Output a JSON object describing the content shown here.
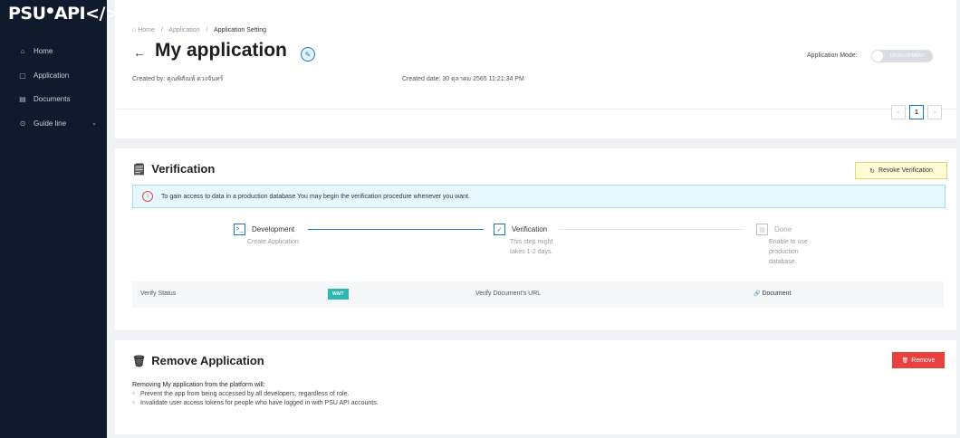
{
  "sidebar": {
    "logo": {
      "part1": "PSU",
      "dot": "●",
      "part2": "API</>"
    },
    "items": [
      {
        "icon": "⌂",
        "label": "Home"
      },
      {
        "icon": "▢",
        "label": "Application"
      },
      {
        "icon": "▤",
        "label": "Documents"
      },
      {
        "icon": "⊙",
        "label": "Guide line",
        "chevron": "⌄"
      }
    ]
  },
  "header": {
    "breadcrumb": [
      "Home",
      "Application",
      "Application Setting"
    ],
    "breadcrumb_sep": "/",
    "home_icon": "⌂",
    "back_icon": "←",
    "title": "My application",
    "edit_icon": "✎",
    "created_by_label": "Created by:",
    "created_by": "คุณพิสัณห์ ดวงจันทร์",
    "created_date_label": "Created date:",
    "created_date": "30 ตุลาคม 2565 11:21:34 PM",
    "mode_label": "Application Mode:",
    "mode_value": "DEVELOPMENT",
    "pager": {
      "prev": "‹",
      "current": "1",
      "next": "›"
    }
  },
  "verification": {
    "icon": "🗒",
    "title": "Verification",
    "revoke_icon": "↻",
    "revoke_label": "Revoke Verification",
    "alert_icon": "!",
    "alert_text": "To gain access to data in a production database You may begin the verification procedure whenever you want.",
    "steps": [
      {
        "icon": ">_",
        "title": "Development",
        "desc": "Create Application"
      },
      {
        "icon": "✓",
        "title": "Verification",
        "desc": "This step might takes 1-2 days."
      },
      {
        "icon": "▤",
        "title": "Done",
        "desc": "Enable to use production database."
      }
    ],
    "status_label": "Verify Status",
    "status_badge": "WAIT",
    "doc_url_label": "Verify Document's URL",
    "doc_link_icon": "🔗",
    "doc_link": "Document"
  },
  "remove": {
    "icon": "🗑",
    "title": "Remove Application",
    "button_icon": "🗑",
    "button_label": "Remove",
    "lead": "Removing My application from the platform will:",
    "items": [
      "Prevent the app from being accessed by all developers, regardless of role.",
      "Invalidate user access tokens for people who have logged in with PSU API accounts."
    ]
  },
  "colors": {
    "sidebar_bg": "#0f1b2d",
    "accent": "#1677c8",
    "alert_bg": "#e6f7ff",
    "badge": "#29b8b2",
    "danger": "#e8423f",
    "revoke_bg": "#fffbd6"
  }
}
